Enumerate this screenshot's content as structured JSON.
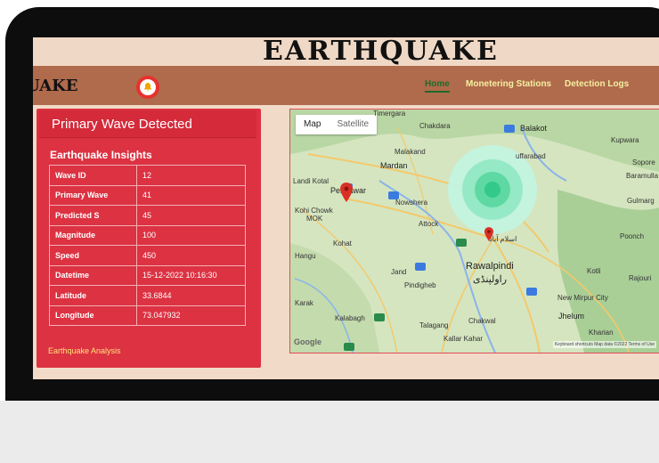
{
  "banner": {
    "title": "EARTHQUAKE"
  },
  "navbar": {
    "brand": "UAKE",
    "links": [
      {
        "label": "Home",
        "active": true
      },
      {
        "label": "Monetering Stations",
        "active": false
      },
      {
        "label": "Detection Logs",
        "active": false
      }
    ],
    "bell_icon": "bell-icon"
  },
  "panel": {
    "title": "Primary Wave Detected",
    "subtitle": "Earthquake Insights",
    "rows": [
      {
        "key": "Wave ID",
        "value": "12"
      },
      {
        "key": "Primary Wave",
        "value": "41"
      },
      {
        "key": "Predicted S",
        "value": "45"
      },
      {
        "key": "Magnitude",
        "value": "100"
      },
      {
        "key": "Speed",
        "value": "450"
      },
      {
        "key": "Datetime",
        "value": "15-12-2022 10:16:30"
      },
      {
        "key": "Latitude",
        "value": "33.6844"
      },
      {
        "key": "Longitude",
        "value": "73.047932"
      }
    ],
    "link": "Earthquake Analysis"
  },
  "map": {
    "tabs": [
      "Map",
      "Satellite"
    ],
    "selected_tab": "Map",
    "labels": {
      "timergara": "Timergara",
      "chakdara": "Chakdara",
      "balakot": "Balakot",
      "kupwara": "Kupwara",
      "malakand": "Malakand",
      "mardan": "Mardan",
      "muzaffarabad": "uffarabad",
      "sopore": "Sopore",
      "baramulla": "Baramulla",
      "landikotal": "Landi Kotal",
      "peshawar": "Peshawar",
      "nowshera": "Nowshera",
      "gulmarg": "Gulmarg",
      "kohichowk": "Kohi Chowk",
      "mok": "MOK",
      "attock": "Attock",
      "poonch": "Poonch",
      "kohat": "Kohat",
      "hangu": "Hangu",
      "jand": "Jand",
      "rawalpindi": "Rawalpindi",
      "rawalpindi_ur": "راولپنڈی",
      "kotli": "Kotli",
      "rajouri": "Rajouri",
      "pindigheb": "Pindigheb",
      "karak": "Karak",
      "newmirpur": "New Mirpur City",
      "kalabagh": "Kalabagh",
      "talagang": "Talagang",
      "chakwal": "Chakwal",
      "jhelum": "Jhelum",
      "kharian": "Kharian",
      "kallarkahar": "Kallar Kahar",
      "islamabad_ur": "اسلام آباد"
    },
    "google": "Google",
    "attribution": "Keyboard shortcuts   Map data ©2022   Terms of Use",
    "colors": {
      "ring_outer": "#bff3dc",
      "ring_mid": "#8fe8c0",
      "ring_inner": "#5ad9a0",
      "ring_core": "#2fc987",
      "pin": "#d93025"
    }
  }
}
